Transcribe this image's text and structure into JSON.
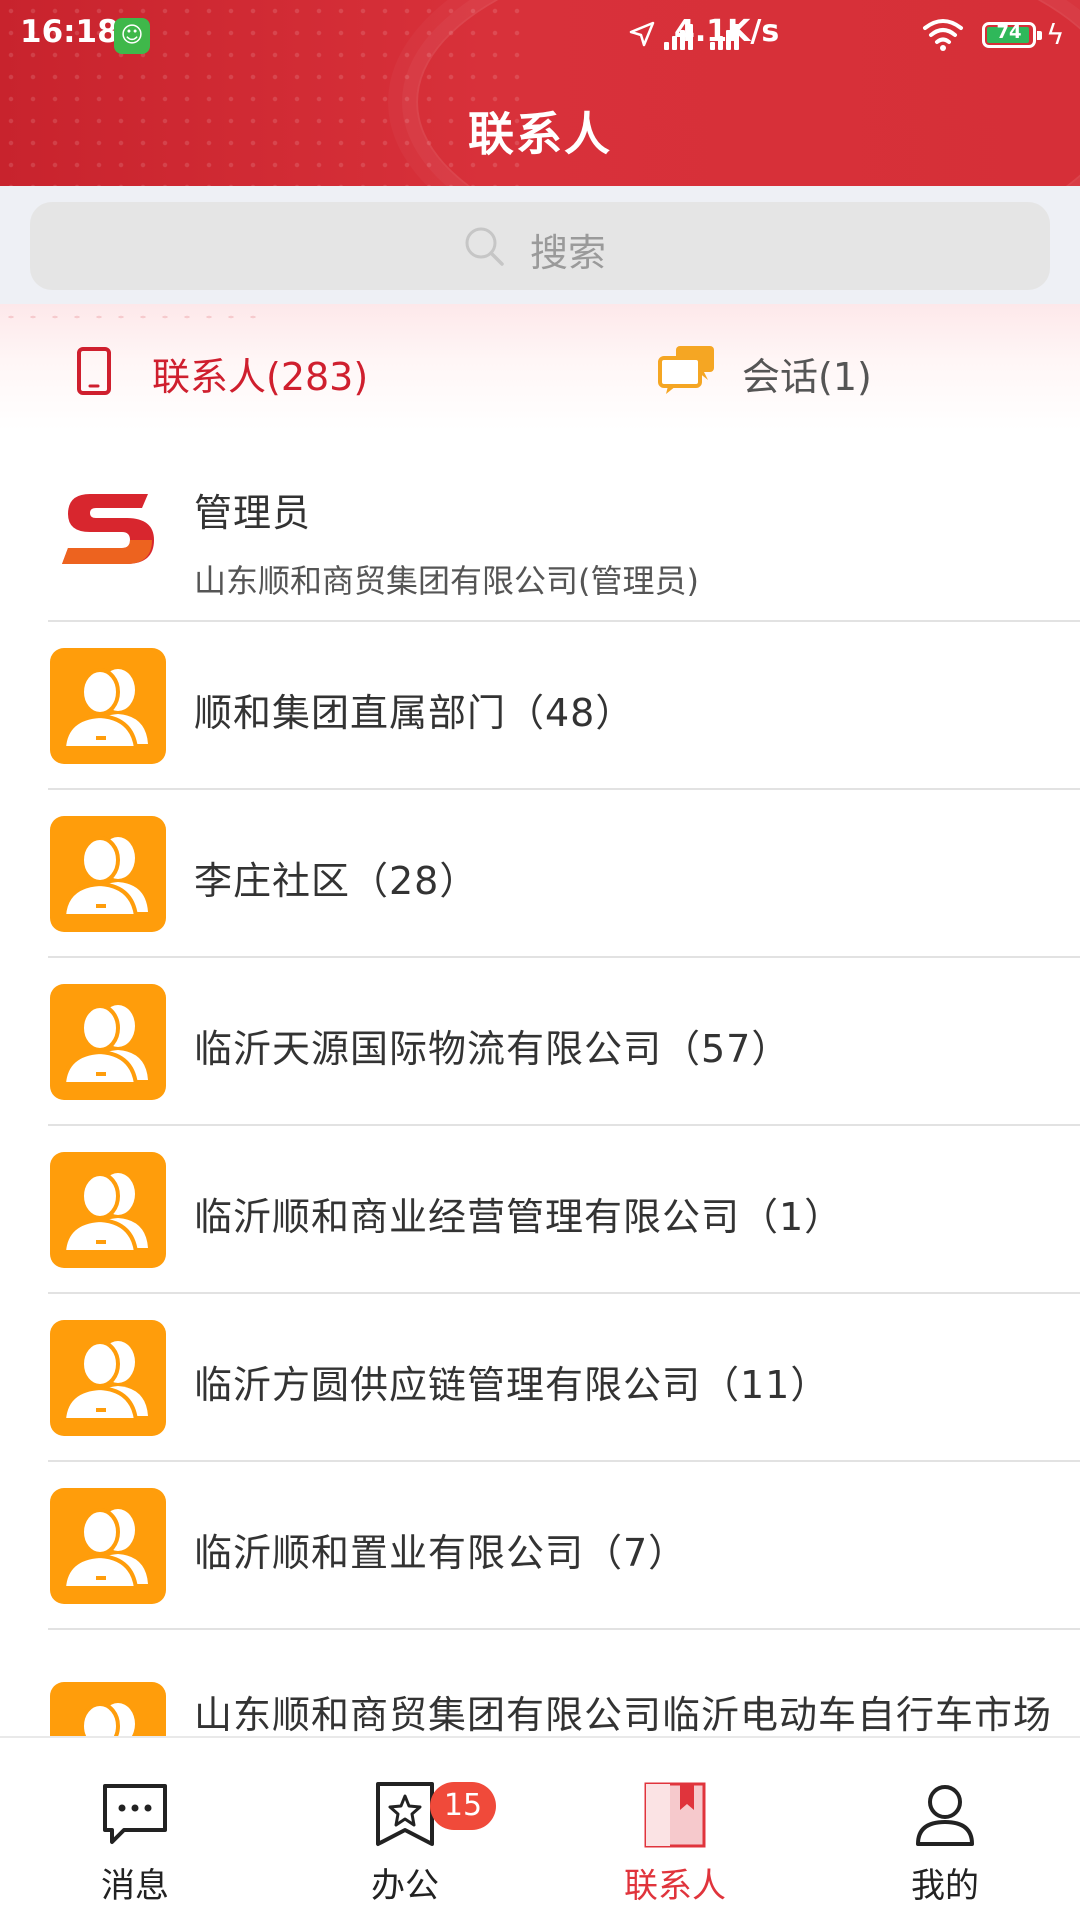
{
  "status_bar": {
    "time": "16:18",
    "network_speed": "4.1K/s",
    "battery": "74"
  },
  "header": {
    "title": "联系人"
  },
  "search": {
    "placeholder": "搜索"
  },
  "tabs": [
    {
      "label": "联系人(283)",
      "active": true,
      "icon": "phone-icon"
    },
    {
      "label": "会话(1)",
      "active": false,
      "icon": "chat-bubbles-icon"
    }
  ],
  "admin": {
    "name": "管理员",
    "subtitle": "山东顺和商贸集团有限公司(管理员)",
    "avatar_icon": "s-logo-icon"
  },
  "groups": [
    {
      "name": "顺和集团直属部门（48）"
    },
    {
      "name": "李庄社区（28）"
    },
    {
      "name": "临沂天源国际物流有限公司（57）"
    },
    {
      "name": "临沂顺和商业经营管理有限公司（1）"
    },
    {
      "name": "临沂方圆供应链管理有限公司（11）"
    },
    {
      "name": "临沂顺和置业有限公司（7）"
    },
    {
      "name": "山东顺和商贸集团有限公司临沂电动车自行车市场"
    }
  ],
  "bottom_nav": [
    {
      "label": "消息",
      "icon": "message-icon",
      "active": false
    },
    {
      "label": "办公",
      "icon": "office-star-icon",
      "active": false,
      "badge": "15"
    },
    {
      "label": "联系人",
      "icon": "contacts-book-icon",
      "active": true
    },
    {
      "label": "我的",
      "icon": "person-icon",
      "active": false
    }
  ],
  "colors": {
    "brand_red": "#d62f38",
    "group_avatar": "#ff9d0b",
    "active_tab": "#cf1f2e"
  }
}
